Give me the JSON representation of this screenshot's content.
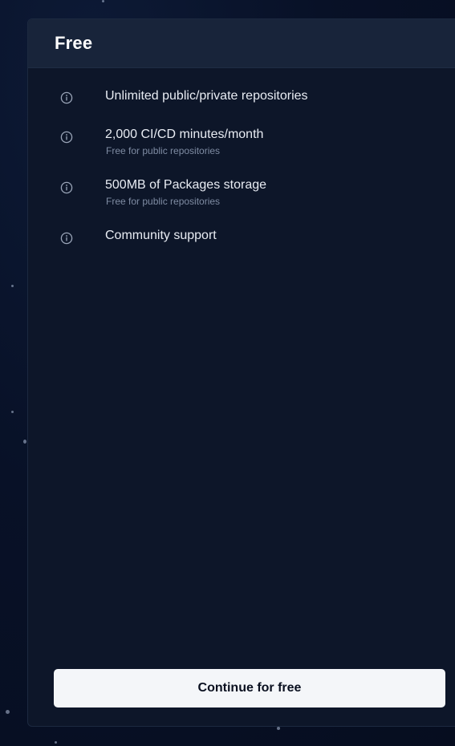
{
  "plan": {
    "title": "Free"
  },
  "features": [
    {
      "label": "Unlimited public/private repositories",
      "sublabel": "",
      "icon": "info-icon"
    },
    {
      "label": "2,000 CI/CD minutes/month",
      "sublabel": "Free for public repositories",
      "icon": "info-icon"
    },
    {
      "label": "500MB of Packages storage",
      "sublabel": "Free for public repositories",
      "icon": "info-icon"
    },
    {
      "label": "Community support",
      "sublabel": "",
      "icon": "info-icon"
    }
  ],
  "cta": {
    "label": "Continue for free"
  },
  "colors": {
    "background": "#081127",
    "card": "#0d1629",
    "header": "#18243a",
    "button": "#f4f6f9",
    "subtext": "#7f8ca3"
  }
}
